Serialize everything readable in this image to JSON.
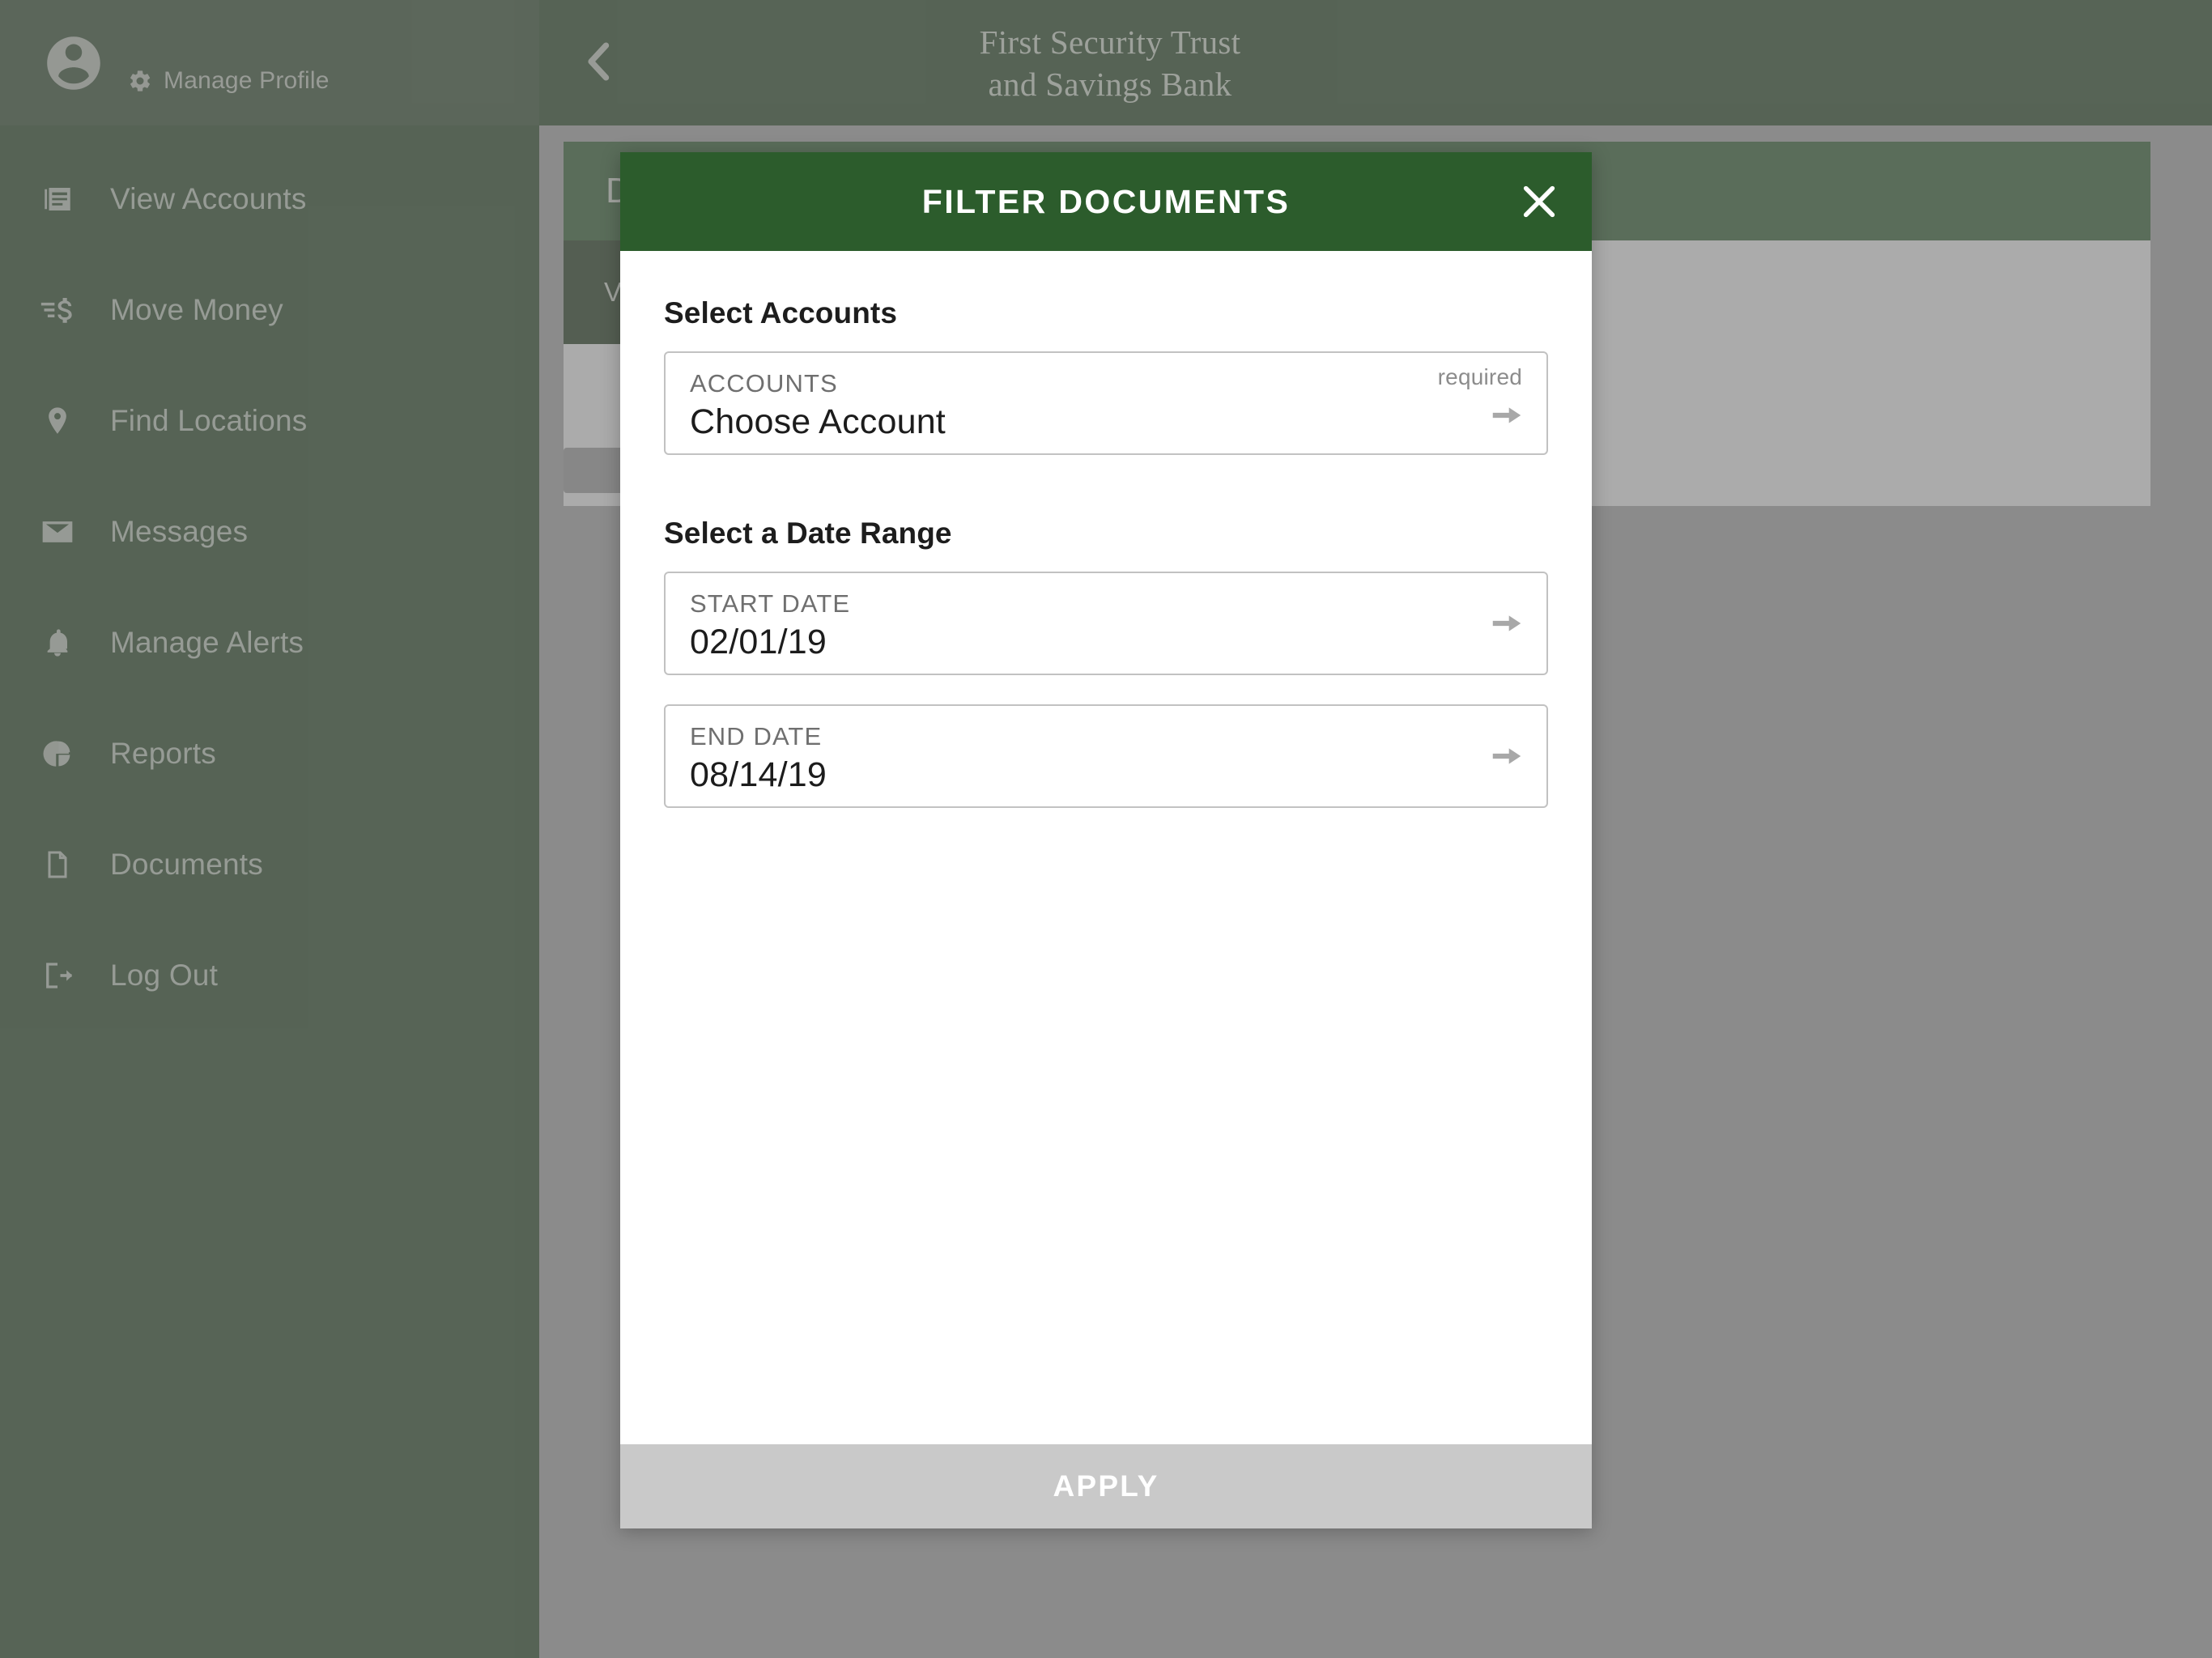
{
  "colors": {
    "sidebar_bg": "#21431e",
    "profile_bg": "#2e4a2c",
    "modal_header_green": "#2c5c2c",
    "page_bg": "#ababab",
    "footer_gray": "#c9c9c9",
    "nav_text": "#c9d4c5"
  },
  "sidebar": {
    "profile": {
      "avatar_icon": "account-circle-icon",
      "gear_icon": "gear-icon",
      "manage_profile_label": "Manage Profile"
    },
    "items": [
      {
        "label": "View Accounts",
        "icon": "accounts-list-icon"
      },
      {
        "label": "Move Money",
        "icon": "transfer-dollar-icon"
      },
      {
        "label": "Find Locations",
        "icon": "map-pin-icon"
      },
      {
        "label": "Messages",
        "icon": "envelope-icon"
      },
      {
        "label": "Manage Alerts",
        "icon": "bell-icon"
      },
      {
        "label": "Reports",
        "icon": "pie-chart-icon"
      },
      {
        "label": "Documents",
        "icon": "document-icon"
      },
      {
        "label": "Log Out",
        "icon": "logout-icon"
      }
    ]
  },
  "header": {
    "back_icon": "chevron-left-icon",
    "bank_name_line1": "First Security Trust",
    "bank_name_line2": "and Savings Bank"
  },
  "background_page": {
    "card_title": "Documents",
    "tabs": [
      {
        "label": "View Documents"
      }
    ]
  },
  "modal": {
    "title": "FILTER DOCUMENTS",
    "close_icon": "close-icon",
    "sections": [
      {
        "label": "Select Accounts",
        "fields": [
          {
            "caption": "ACCOUNTS",
            "value": "Choose Account",
            "required_label": "required",
            "arrow_icon": "arrow-right-icon"
          }
        ]
      },
      {
        "label": "Select a Date Range",
        "fields": [
          {
            "caption": "START DATE",
            "value": "02/01/19",
            "arrow_icon": "arrow-right-icon"
          },
          {
            "caption": "END DATE",
            "value": "08/14/19",
            "arrow_icon": "arrow-right-icon"
          }
        ]
      }
    ],
    "apply_label": "APPLY"
  }
}
